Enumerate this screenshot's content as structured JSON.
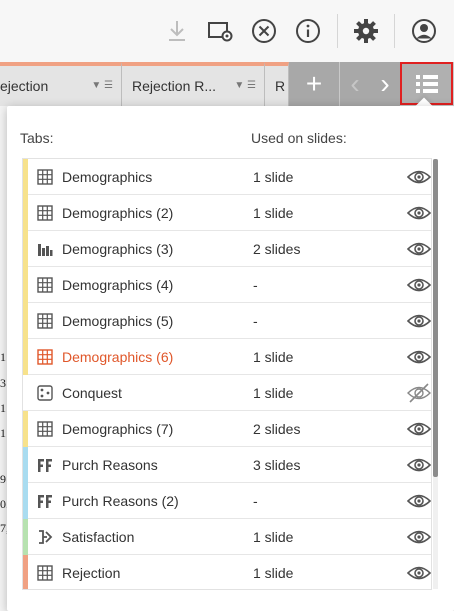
{
  "toolbar": {
    "icons": [
      "download-icon",
      "preview-settings-icon",
      "close-circle-icon",
      "info-icon",
      "gear-icon",
      "user-account-icon"
    ]
  },
  "tabs": [
    {
      "label": "ejection"
    },
    {
      "label": "Rejection R..."
    },
    {
      "label": "R"
    }
  ],
  "tab_nav": {
    "add": "+",
    "prev": "‹",
    "next": "›"
  },
  "background_fragments": [
    "1",
    "3",
    "1",
    "1",
    "9",
    "0.",
    "7,"
  ],
  "panel": {
    "tabs_header": "Tabs:",
    "used_header": "Used on slides:",
    "rows": [
      {
        "name": "Demographics",
        "slides": "1 slide",
        "icon": "table-icon",
        "stripe": "#f7e28c",
        "visible": true,
        "selected": false
      },
      {
        "name": "Demographics (2)",
        "slides": "1 slide",
        "icon": "table-icon",
        "stripe": "#f7e28c",
        "visible": true,
        "selected": false
      },
      {
        "name": "Demographics (3)",
        "slides": "2 slides",
        "icon": "bar-chart-icon",
        "stripe": "#f7e28c",
        "visible": true,
        "selected": false
      },
      {
        "name": "Demographics (4)",
        "slides": "-",
        "icon": "table-icon",
        "stripe": "#f7e28c",
        "visible": true,
        "selected": false
      },
      {
        "name": "Demographics (5)",
        "slides": "-",
        "icon": "table-icon",
        "stripe": "#f7e28c",
        "visible": true,
        "selected": false
      },
      {
        "name": "Demographics (6)",
        "slides": "1 slide",
        "icon": "table-icon",
        "stripe": "#f7e28c",
        "visible": true,
        "selected": true
      },
      {
        "name": "Conquest",
        "slides": "1 slide",
        "icon": "dice-icon",
        "stripe": "",
        "visible": false,
        "selected": false
      },
      {
        "name": "Demographics (7)",
        "slides": "2 slides",
        "icon": "table-icon",
        "stripe": "#f7e28c",
        "visible": true,
        "selected": false
      },
      {
        "name": "Purch Reasons",
        "slides": "3 slides",
        "icon": "ff-icon",
        "stripe": "#a9dcf0",
        "visible": true,
        "selected": false
      },
      {
        "name": "Purch Reasons (2)",
        "slides": "-",
        "icon": "ff-icon",
        "stripe": "#a9dcf0",
        "visible": true,
        "selected": false
      },
      {
        "name": "Satisfaction",
        "slides": "1 slide",
        "icon": "flow-icon",
        "stripe": "#b7e2b0",
        "visible": true,
        "selected": false
      },
      {
        "name": "Rejection",
        "slides": "1 slide",
        "icon": "table-icon",
        "stripe": "#f0a183",
        "visible": true,
        "selected": false
      }
    ]
  },
  "colors": {
    "accent_orange": "#e0572a",
    "highlight_red": "#e02020",
    "tab_border": "#f0a183"
  }
}
